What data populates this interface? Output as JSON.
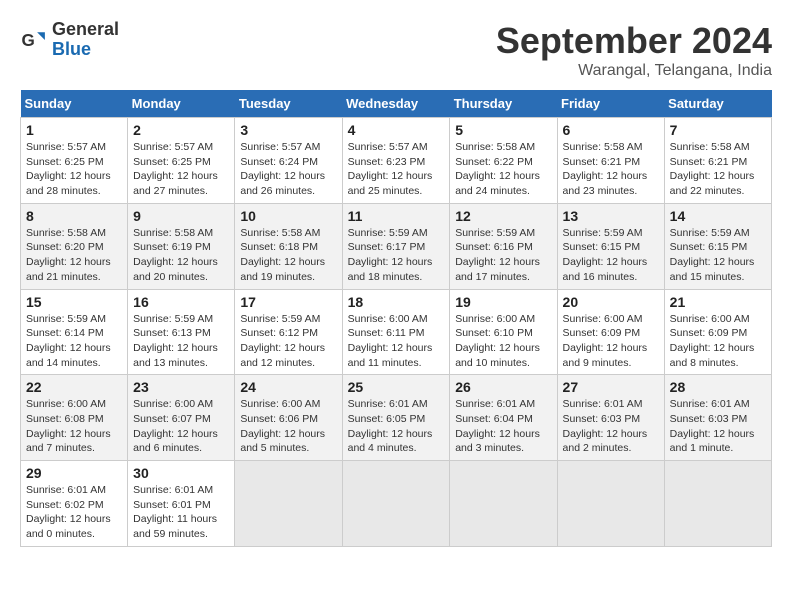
{
  "header": {
    "logo_general": "General",
    "logo_blue": "Blue",
    "month_title": "September 2024",
    "location": "Warangal, Telangana, India"
  },
  "columns": [
    "Sunday",
    "Monday",
    "Tuesday",
    "Wednesday",
    "Thursday",
    "Friday",
    "Saturday"
  ],
  "weeks": [
    [
      {
        "day": "1",
        "info": "Sunrise: 5:57 AM\nSunset: 6:25 PM\nDaylight: 12 hours\nand 28 minutes."
      },
      {
        "day": "2",
        "info": "Sunrise: 5:57 AM\nSunset: 6:25 PM\nDaylight: 12 hours\nand 27 minutes."
      },
      {
        "day": "3",
        "info": "Sunrise: 5:57 AM\nSunset: 6:24 PM\nDaylight: 12 hours\nand 26 minutes."
      },
      {
        "day": "4",
        "info": "Sunrise: 5:57 AM\nSunset: 6:23 PM\nDaylight: 12 hours\nand 25 minutes."
      },
      {
        "day": "5",
        "info": "Sunrise: 5:58 AM\nSunset: 6:22 PM\nDaylight: 12 hours\nand 24 minutes."
      },
      {
        "day": "6",
        "info": "Sunrise: 5:58 AM\nSunset: 6:21 PM\nDaylight: 12 hours\nand 23 minutes."
      },
      {
        "day": "7",
        "info": "Sunrise: 5:58 AM\nSunset: 6:21 PM\nDaylight: 12 hours\nand 22 minutes."
      }
    ],
    [
      {
        "day": "8",
        "info": "Sunrise: 5:58 AM\nSunset: 6:20 PM\nDaylight: 12 hours\nand 21 minutes."
      },
      {
        "day": "9",
        "info": "Sunrise: 5:58 AM\nSunset: 6:19 PM\nDaylight: 12 hours\nand 20 minutes."
      },
      {
        "day": "10",
        "info": "Sunrise: 5:58 AM\nSunset: 6:18 PM\nDaylight: 12 hours\nand 19 minutes."
      },
      {
        "day": "11",
        "info": "Sunrise: 5:59 AM\nSunset: 6:17 PM\nDaylight: 12 hours\nand 18 minutes."
      },
      {
        "day": "12",
        "info": "Sunrise: 5:59 AM\nSunset: 6:16 PM\nDaylight: 12 hours\nand 17 minutes."
      },
      {
        "day": "13",
        "info": "Sunrise: 5:59 AM\nSunset: 6:15 PM\nDaylight: 12 hours\nand 16 minutes."
      },
      {
        "day": "14",
        "info": "Sunrise: 5:59 AM\nSunset: 6:15 PM\nDaylight: 12 hours\nand 15 minutes."
      }
    ],
    [
      {
        "day": "15",
        "info": "Sunrise: 5:59 AM\nSunset: 6:14 PM\nDaylight: 12 hours\nand 14 minutes."
      },
      {
        "day": "16",
        "info": "Sunrise: 5:59 AM\nSunset: 6:13 PM\nDaylight: 12 hours\nand 13 minutes."
      },
      {
        "day": "17",
        "info": "Sunrise: 5:59 AM\nSunset: 6:12 PM\nDaylight: 12 hours\nand 12 minutes."
      },
      {
        "day": "18",
        "info": "Sunrise: 6:00 AM\nSunset: 6:11 PM\nDaylight: 12 hours\nand 11 minutes."
      },
      {
        "day": "19",
        "info": "Sunrise: 6:00 AM\nSunset: 6:10 PM\nDaylight: 12 hours\nand 10 minutes."
      },
      {
        "day": "20",
        "info": "Sunrise: 6:00 AM\nSunset: 6:09 PM\nDaylight: 12 hours\nand 9 minutes."
      },
      {
        "day": "21",
        "info": "Sunrise: 6:00 AM\nSunset: 6:09 PM\nDaylight: 12 hours\nand 8 minutes."
      }
    ],
    [
      {
        "day": "22",
        "info": "Sunrise: 6:00 AM\nSunset: 6:08 PM\nDaylight: 12 hours\nand 7 minutes."
      },
      {
        "day": "23",
        "info": "Sunrise: 6:00 AM\nSunset: 6:07 PM\nDaylight: 12 hours\nand 6 minutes."
      },
      {
        "day": "24",
        "info": "Sunrise: 6:00 AM\nSunset: 6:06 PM\nDaylight: 12 hours\nand 5 minutes."
      },
      {
        "day": "25",
        "info": "Sunrise: 6:01 AM\nSunset: 6:05 PM\nDaylight: 12 hours\nand 4 minutes."
      },
      {
        "day": "26",
        "info": "Sunrise: 6:01 AM\nSunset: 6:04 PM\nDaylight: 12 hours\nand 3 minutes."
      },
      {
        "day": "27",
        "info": "Sunrise: 6:01 AM\nSunset: 6:03 PM\nDaylight: 12 hours\nand 2 minutes."
      },
      {
        "day": "28",
        "info": "Sunrise: 6:01 AM\nSunset: 6:03 PM\nDaylight: 12 hours\nand 1 minute."
      }
    ],
    [
      {
        "day": "29",
        "info": "Sunrise: 6:01 AM\nSunset: 6:02 PM\nDaylight: 12 hours\nand 0 minutes."
      },
      {
        "day": "30",
        "info": "Sunrise: 6:01 AM\nSunset: 6:01 PM\nDaylight: 11 hours\nand 59 minutes."
      },
      {
        "day": "",
        "info": ""
      },
      {
        "day": "",
        "info": ""
      },
      {
        "day": "",
        "info": ""
      },
      {
        "day": "",
        "info": ""
      },
      {
        "day": "",
        "info": ""
      }
    ]
  ]
}
